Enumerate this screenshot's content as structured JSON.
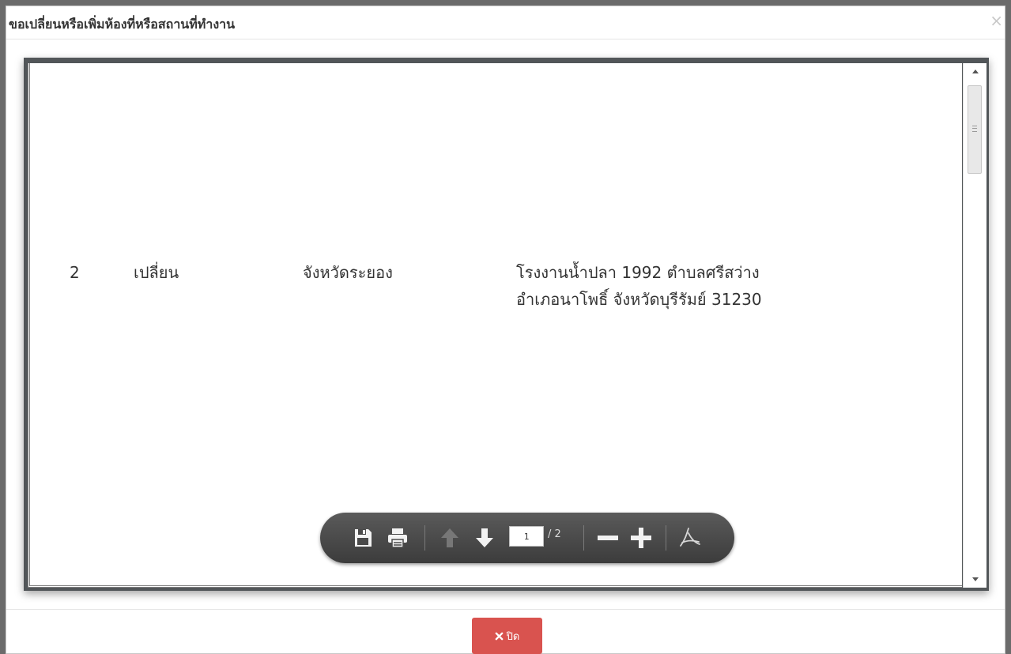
{
  "modal": {
    "title": "ขอเปลี่ยนหรือเพิ่มห้องที่หรือสถานที่ทำงาน",
    "close_symbol": "×"
  },
  "document": {
    "row": {
      "number": "2",
      "type": "เปลี่ยน",
      "province": "จังหวัดระยอง",
      "address": "โรงงานน้ำปลา 1992 ตำบลศรีสว่าง อำเภอนาโพธิ์ จังหวัดบุรีรัมย์ 31230"
    }
  },
  "pdf_toolbar": {
    "icons": [
      "save-icon",
      "print-icon",
      "page-up-icon",
      "page-down-icon",
      "zoom-out-icon",
      "zoom-in-icon",
      "acrobat-icon"
    ],
    "current_page": "1",
    "total_pages": "/ 2"
  },
  "footer": {
    "close_button_label": "ปิด",
    "close_button_color": "#d9534f"
  }
}
